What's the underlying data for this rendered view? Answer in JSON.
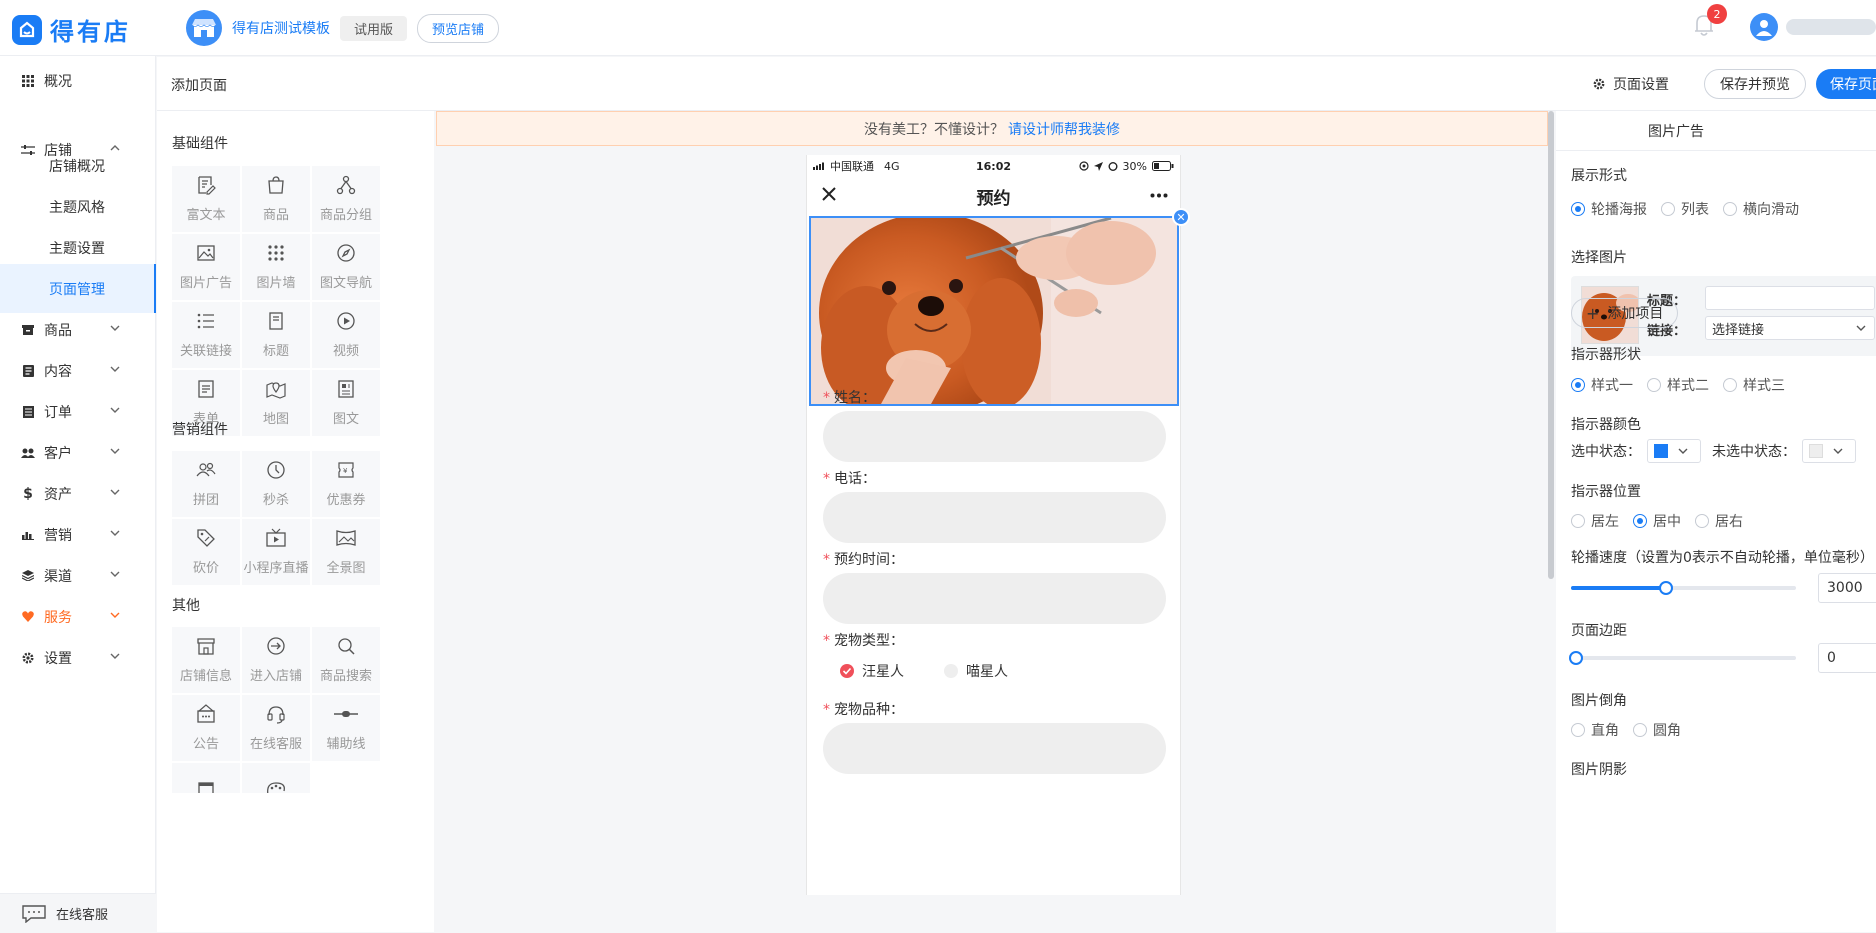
{
  "app": {
    "brand": "得有店"
  },
  "header": {
    "shop_name": "得有店测试模板",
    "trial_badge": "试用版",
    "preview_button": "预览店铺",
    "notification_count": "2"
  },
  "sidebar": {
    "items": [
      {
        "label": "概况",
        "icon": "grid-icon"
      },
      {
        "label": "店铺",
        "icon": "sliders-icon"
      },
      {
        "label": "店铺概况"
      },
      {
        "label": "主题风格"
      },
      {
        "label": "主题设置"
      },
      {
        "label": "页面管理"
      },
      {
        "label": "商品",
        "icon": "box-icon"
      },
      {
        "label": "内容",
        "icon": "doc-icon"
      },
      {
        "label": "订单",
        "icon": "list-icon"
      },
      {
        "label": "客户",
        "icon": "users-icon"
      },
      {
        "label": "资产",
        "icon": "dollar-icon"
      },
      {
        "label": "营销",
        "icon": "bar-chart-icon"
      },
      {
        "label": "渠道",
        "icon": "layers-icon"
      },
      {
        "label": "服务",
        "icon": "heart-icon"
      },
      {
        "label": "设置",
        "icon": "gear-icon"
      }
    ],
    "customer_service": "在线客服"
  },
  "subheader": {
    "page_title": "添加页面",
    "page_settings": "页面设置",
    "save_preview": "保存并预览",
    "save_page": "保存页面"
  },
  "components": {
    "basic_title": "基础组件",
    "basic": [
      "富文本",
      "商品",
      "商品分组",
      "图片广告",
      "图片墙",
      "图文导航",
      "关联链接",
      "标题",
      "视频",
      "表单",
      "地图",
      "图文"
    ],
    "marketing_title": "营销组件",
    "marketing": [
      "拼团",
      "秒杀",
      "优惠券",
      "砍价",
      "小程序直播",
      "全景图"
    ],
    "other_title": "其他",
    "other": [
      "店铺信息",
      "进入店铺",
      "商品搜索",
      "公告",
      "在线客服",
      "辅助线"
    ]
  },
  "canvas": {
    "tip_text": "没有美工？不懂设计？",
    "tip_link": "请设计师帮我装修"
  },
  "phone": {
    "carrier": "中国联通",
    "network": "4G",
    "time": "16:02",
    "battery": "30%",
    "nav_title": "预约",
    "form": {
      "name_label": "姓名：",
      "phone_label": "电话：",
      "time_label": "预约时间：",
      "pet_type_label": "宠物类型：",
      "pet_type_options": [
        "汪星人",
        "喵星人"
      ],
      "pet_breed_label": "宠物品种："
    }
  },
  "right_panel": {
    "title": "图片广告",
    "display_label": "展示形式",
    "display_options": [
      "轮播海报",
      "列表",
      "横向滑动"
    ],
    "select_image_label": "选择图片",
    "item_title_label": "标题：",
    "item_link_label": "链接：",
    "item_link_value": "选择链接",
    "add_item": "添加项目",
    "indicator_shape_label": "指示器形状",
    "indicator_shape_options": [
      "样式一",
      "样式二",
      "样式三"
    ],
    "indicator_color_label": "指示器颜色",
    "selected_state": "选中状态：",
    "unselected_state": "未选中状态：",
    "indicator_pos_label": "指示器位置",
    "indicator_pos_options": [
      "居左",
      "居中",
      "居右"
    ],
    "speed_label": "轮播速度（设置为0表示不自动轮播，单位毫秒）",
    "speed_value": "3000",
    "speed_ratio": 0.42,
    "margin_label": "页面边距",
    "margin_value": "0",
    "margin_ratio": 0,
    "corner_label": "图片倒角",
    "corner_options": [
      "直角",
      "圆角"
    ],
    "shadow_label": "图片阴影"
  },
  "colors": {
    "accent": "#1a7cf5",
    "warning_bg": "#fff2e8",
    "badge": "#f04040",
    "service": "#ff6a22",
    "required": "#f0505a",
    "selected_indicator": "#1a7cf5",
    "unselected_indicator": "#eeeeee"
  }
}
